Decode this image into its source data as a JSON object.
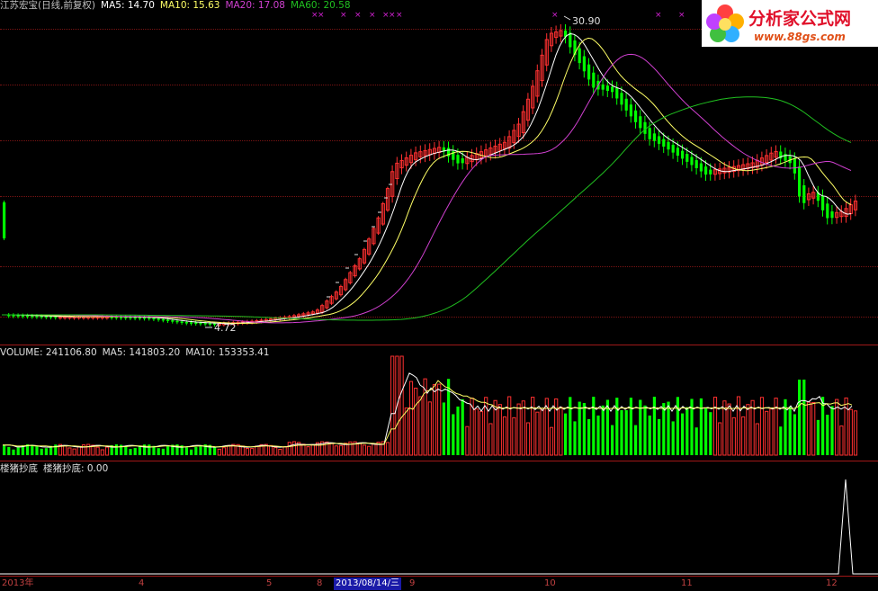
{
  "main_panel": {
    "stock_label": "江苏宏宝(日线,前复权)",
    "ma5_label": "MA5: 14.70",
    "ma10_label": "MA10: 15.63",
    "ma20_label": "MA20: 17.08",
    "ma60_label": "MA60: 20.58",
    "high_price_label": "30.90",
    "low_price_label": "4.72",
    "colors": {
      "ma5": "#ffffff",
      "ma10": "#ffff66",
      "ma20": "#d040d0",
      "ma60": "#20c020",
      "up": "#ff3030",
      "down": "#00ff00",
      "marker": "#d020d0"
    }
  },
  "volume_panel": {
    "volume_label": "VOLUME: 241106.80",
    "ma5_label": "MA5: 141803.20",
    "ma10_label": "MA10: 153353.41"
  },
  "indicator_panel": {
    "name_label": "楼猪抄底",
    "value_label": "楼猪抄底: 0.00"
  },
  "date_axis": {
    "labels": [
      "2013年",
      "4",
      "5",
      "8",
      "9",
      "10",
      "11",
      "12"
    ],
    "cursor_date": "2013/08/14/三"
  },
  "logo": {
    "title": "分析家公式网",
    "url": "www.88gs.com"
  }
}
